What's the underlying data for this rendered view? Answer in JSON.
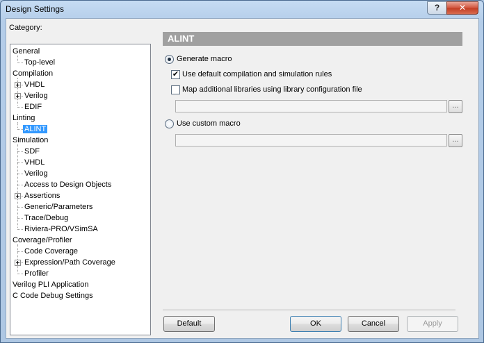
{
  "window": {
    "title": "Design Settings",
    "help_glyph": "?",
    "close_glyph": "✕"
  },
  "category_label": "Category:",
  "tree": [
    {
      "label": "General",
      "level": 0,
      "expander": false
    },
    {
      "label": "Top-level",
      "level": 1,
      "expander": false
    },
    {
      "label": "Compilation",
      "level": 0,
      "expander": false
    },
    {
      "label": "VHDL",
      "level": 1,
      "expander": true
    },
    {
      "label": "Verilog",
      "level": 1,
      "expander": true
    },
    {
      "label": "EDIF",
      "level": 1,
      "expander": false
    },
    {
      "label": "Linting",
      "level": 0,
      "expander": false
    },
    {
      "label": "ALINT",
      "level": 1,
      "expander": false,
      "selected": true
    },
    {
      "label": "Simulation",
      "level": 0,
      "expander": false
    },
    {
      "label": "SDF",
      "level": 1,
      "expander": false
    },
    {
      "label": "VHDL",
      "level": 1,
      "expander": false
    },
    {
      "label": "Verilog",
      "level": 1,
      "expander": false
    },
    {
      "label": "Access to Design Objects",
      "level": 1,
      "expander": false
    },
    {
      "label": "Assertions",
      "level": 1,
      "expander": true
    },
    {
      "label": "Generic/Parameters",
      "level": 1,
      "expander": false
    },
    {
      "label": "Trace/Debug",
      "level": 1,
      "expander": false
    },
    {
      "label": "Riviera-PRO/VSimSA",
      "level": 1,
      "expander": false
    },
    {
      "label": "Coverage/Profiler",
      "level": 0,
      "expander": false
    },
    {
      "label": "Code Coverage",
      "level": 1,
      "expander": false
    },
    {
      "label": "Expression/Path Coverage",
      "level": 1,
      "expander": true
    },
    {
      "label": "Profiler",
      "level": 1,
      "expander": false
    },
    {
      "label": "Verilog PLI Application",
      "level": 0,
      "expander": false
    },
    {
      "label": "C Code Debug Settings",
      "level": 0,
      "expander": false
    }
  ],
  "panel": {
    "header": "ALINT",
    "generate_macro": {
      "label": "Generate macro",
      "checked": true
    },
    "use_default_rules": {
      "label": "Use default compilation and simulation rules",
      "checked": true,
      "mark": "✔"
    },
    "map_libraries": {
      "label": "Map additional libraries using library configuration file",
      "checked": false
    },
    "library_file_value": "",
    "use_custom_macro": {
      "label": "Use custom macro",
      "checked": false
    },
    "custom_macro_value": "",
    "browse_label": "..."
  },
  "buttons": {
    "default": "Default",
    "ok": "OK",
    "cancel": "Cancel",
    "apply": "Apply"
  }
}
